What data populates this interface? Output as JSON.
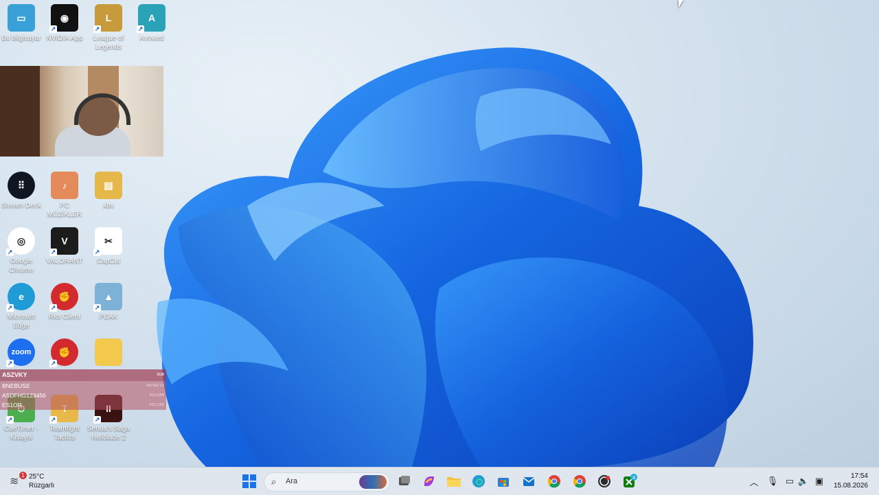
{
  "desktop": {
    "icons": [
      {
        "id": "this-pc",
        "label": "Bu bilgisayar",
        "color": "#3aa0d8",
        "glyph": "▭"
      },
      {
        "id": "nvidia",
        "label": "NVIDIA App",
        "color": "#111111",
        "glyph": "◉"
      },
      {
        "id": "lol",
        "label": "League of Legends",
        "color": "#c79b3b",
        "glyph": "L"
      },
      {
        "id": "avowed",
        "label": "Avowed",
        "color": "#2aa3b8",
        "glyph": "A"
      },
      {
        "id": "stream-deck",
        "label": "Stream Deck",
        "color": "#0f1622",
        "glyph": "⠿"
      },
      {
        "id": "pc-muzikler",
        "label": "PC MÜZİKLER",
        "color": "#e58a5a",
        "glyph": "♪"
      },
      {
        "id": "xbs",
        "label": "xbs",
        "color": "#e6b84a",
        "glyph": "▤"
      },
      {
        "id": "chrome",
        "label": "Google Chrome",
        "color": "#ffffff",
        "glyph": "◎"
      },
      {
        "id": "valorant",
        "label": "VALORANT",
        "color": "#1c1c1c",
        "glyph": "V"
      },
      {
        "id": "capcut",
        "label": "CapCut",
        "color": "#ffffff",
        "glyph": "✂"
      },
      {
        "id": "edge",
        "label": "Microsoft Edge",
        "color": "#1f9bd6",
        "glyph": "e"
      },
      {
        "id": "riot",
        "label": "Riot Client",
        "color": "#d22a2f",
        "glyph": "✊"
      },
      {
        "id": "peak",
        "label": "PEAK",
        "color": "#7db1d6",
        "glyph": "▲"
      },
      {
        "id": "zoom",
        "label": "",
        "color": "#1e6ff0",
        "glyph": "zoom"
      },
      {
        "id": "riot2",
        "label": "",
        "color": "#d22a2f",
        "glyph": "✊"
      },
      {
        "id": "folder",
        "label": "",
        "color": "#f2c94c",
        "glyph": ""
      },
      {
        "id": "cuetimer",
        "label": "CueTimer - Kisayol",
        "color": "#4cae4f",
        "glyph": "⏱"
      },
      {
        "id": "tft",
        "label": "Teamfight Tactics",
        "color": "#e8b848",
        "glyph": "T"
      },
      {
        "id": "hellblade",
        "label": "Senua's Saga Hellblade 2",
        "color": "#3b1212",
        "glyph": "II"
      }
    ]
  },
  "overlay": {
    "rows": [
      {
        "name": "ASZVKY",
        "tag": "SUB"
      },
      {
        "name": "BNEBUSE",
        "tag": "GIFTED X1"
      },
      {
        "name": "ASDFHG123456",
        "tag": "FOLLOW"
      },
      {
        "name": "ES1OR",
        "tag": "FOLLOW"
      }
    ]
  },
  "taskbar": {
    "weather": {
      "temp": "25°C",
      "condition": "Rüzgarlı",
      "badge": "1"
    },
    "search": {
      "placeholder": "Ara"
    },
    "clock": {
      "time": "17:54",
      "date": "15.08.2026"
    },
    "xbox_badge": "4"
  }
}
